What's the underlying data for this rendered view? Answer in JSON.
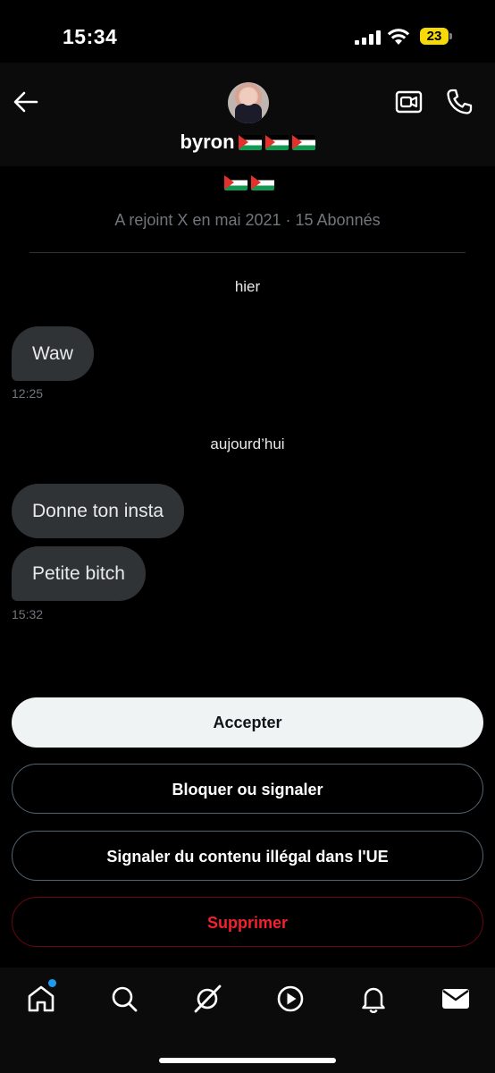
{
  "status_bar": {
    "time": "15:34",
    "battery": "23"
  },
  "header": {
    "username": "byron"
  },
  "profile": {
    "joined": "A rejoint X en mai 2021 · 15 Abonnés"
  },
  "conversation": {
    "groups": [
      {
        "day": "hier",
        "messages": [
          "Waw"
        ],
        "time": "12:25"
      },
      {
        "day": "aujourd’hui",
        "messages": [
          "Donne ton insta",
          "Petite bitch"
        ],
        "time": "15:32"
      }
    ]
  },
  "actions": {
    "accept": "Accepter",
    "block": "Bloquer ou signaler",
    "report_eu": "Signaler du contenu illégal dans l'UE",
    "delete": "Supprimer"
  },
  "nav": [
    "home-icon",
    "search-icon",
    "grok-icon",
    "video-icon",
    "notifications-icon",
    "messages-icon"
  ],
  "colors": {
    "accent": "#1d9bf0",
    "danger": "#f4212e",
    "bubble": "#2f3336",
    "battery": "#f5d90a"
  }
}
